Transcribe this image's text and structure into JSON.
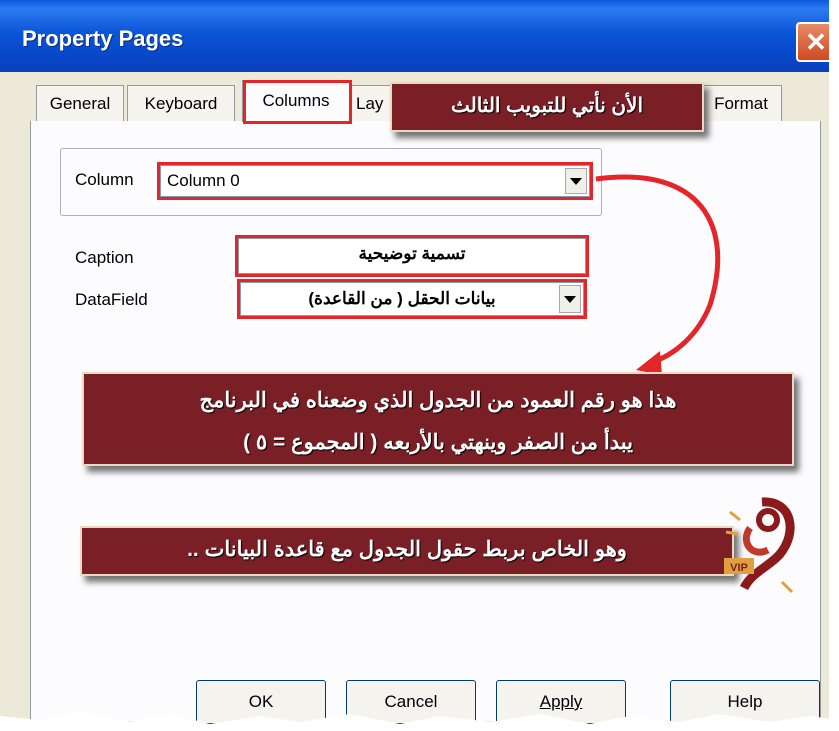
{
  "window": {
    "title": "Property Pages"
  },
  "tabs": [
    {
      "label": "General",
      "active": false
    },
    {
      "label": "Keyboard",
      "active": false
    },
    {
      "label": "Columns",
      "active": true
    },
    {
      "label": "Lay",
      "active": false
    },
    {
      "label": "Format",
      "active": false
    }
  ],
  "column_field": {
    "label": "Column",
    "value": "Column 0"
  },
  "caption_field": {
    "label": "Caption",
    "value": "تسمية توضيحية"
  },
  "datafield_field": {
    "label": "DataField",
    "value": "بيانات الحقل ( من القاعدة)"
  },
  "annotations": {
    "third_tab": "الأن نأتي للتبويب الثالث",
    "column_note_line1": "هذا هو رقم العمود من الجدول الذي وضعناه في البرنامج",
    "column_note_line2": "يبدأ من الصفر وينهتي بالأربعه ( المجموع = ٥ )",
    "datafield_note": "وهو الخاص بربط حقول الجدول مع قاعدة البيانات .."
  },
  "logo": {
    "text": "VIP"
  },
  "buttons": {
    "ok": "OK",
    "cancel": "Cancel",
    "apply": "Apply",
    "help": "Help"
  },
  "colors": {
    "annotation_bg": "#7a1f26",
    "highlight": "#e4262b",
    "arrow": "#e4262b",
    "titlebar": "#0846c8"
  }
}
